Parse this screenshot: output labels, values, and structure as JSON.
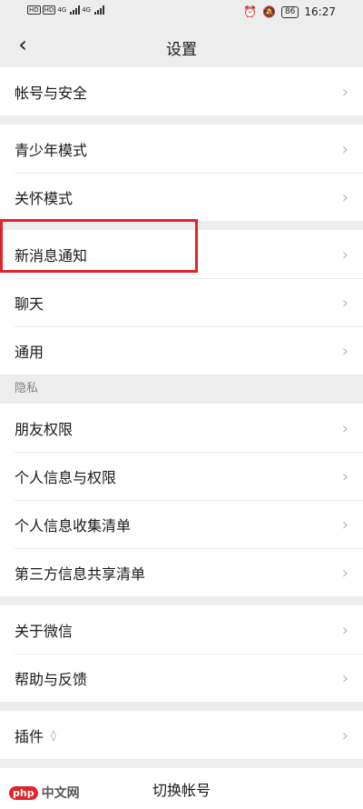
{
  "status_bar": {
    "hd_badges": [
      "HD",
      "HD"
    ],
    "network_left": "4G",
    "network_right": "4G",
    "battery": "86",
    "time": "16:27"
  },
  "header": {
    "title": "设置",
    "back_icon": "chevron-left-icon"
  },
  "rows": {
    "account_security": "帐号与安全",
    "teen_mode": "青少年模式",
    "care_mode": "关怀模式",
    "new_message_notify": "新消息通知",
    "chat": "聊天",
    "general": "通用",
    "privacy_header": "隐私",
    "friend_permissions": "朋友权限",
    "personal_info_permissions": "个人信息与权限",
    "personal_info_collection": "个人信息收集清单",
    "third_party_sharing": "第三方信息共享清单",
    "about_wechat": "关于微信",
    "help_feedback": "帮助与反馈",
    "plugins": "插件",
    "switch_account": "切换帐号"
  },
  "watermark": {
    "logo": "php",
    "text": "中文网"
  },
  "colors": {
    "background": "#ededed",
    "highlight": "#e1242b",
    "chevron": "#b8b8b8"
  }
}
